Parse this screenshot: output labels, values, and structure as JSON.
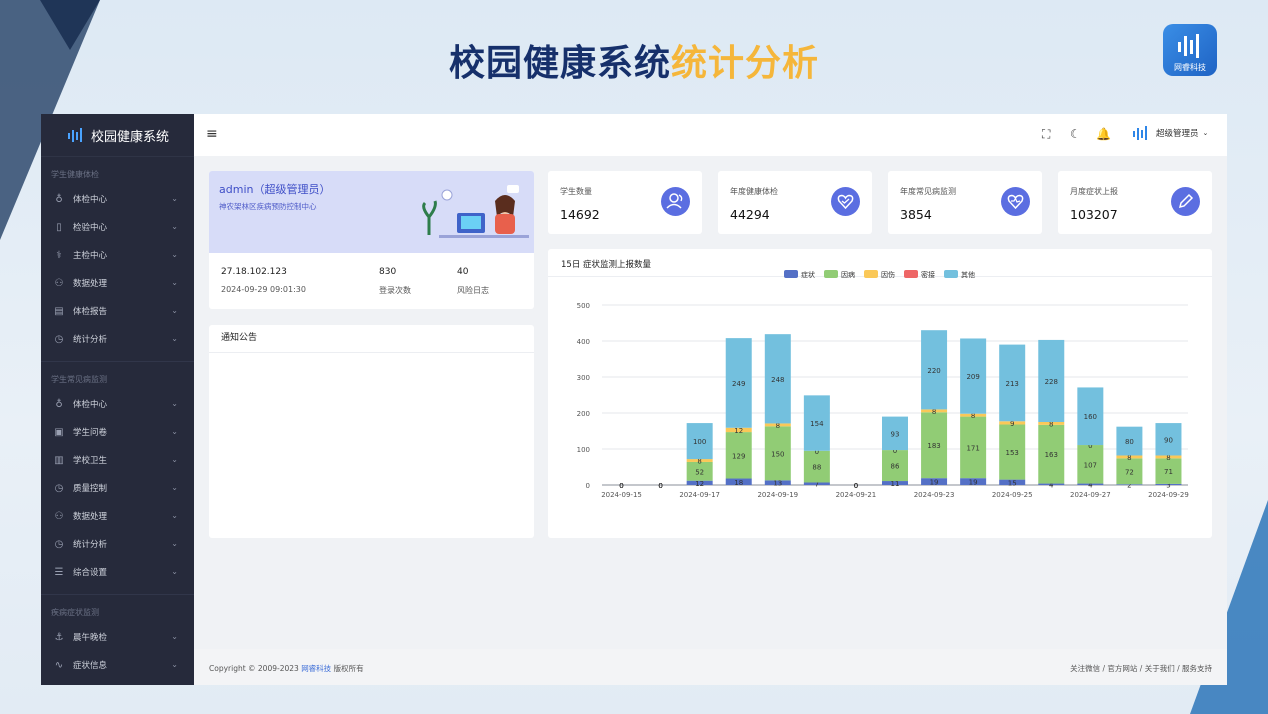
{
  "slide": {
    "title_main": "校园健康系统",
    "title_accent": "统计分析",
    "brand_name": "网睿科技"
  },
  "colors": {
    "accent": "#5b6ee1",
    "title": "#16306b",
    "title_accent": "#f5b63a",
    "sidebar": "#262a3b"
  },
  "sidebar": {
    "app_name": "校园健康系统",
    "sections": [
      {
        "title": "学生健康体检",
        "items": [
          {
            "label": "体检中心",
            "icon": "stethoscope-icon",
            "glyph": "♁"
          },
          {
            "label": "检验中心",
            "icon": "test-tube-icon",
            "glyph": "▯"
          },
          {
            "label": "主检中心",
            "icon": "doctor-icon",
            "glyph": "⚕"
          },
          {
            "label": "数据处理",
            "icon": "hierarchy-icon",
            "glyph": "⚇"
          },
          {
            "label": "体检报告",
            "icon": "report-icon",
            "glyph": "▤"
          },
          {
            "label": "统计分析",
            "icon": "clock-icon",
            "glyph": "◷"
          }
        ]
      },
      {
        "title": "学生常见病监测",
        "items": [
          {
            "label": "体检中心",
            "icon": "stethoscope-icon",
            "glyph": "♁"
          },
          {
            "label": "学生问卷",
            "icon": "document-icon",
            "glyph": "▣"
          },
          {
            "label": "学校卫生",
            "icon": "building-icon",
            "glyph": "▥"
          },
          {
            "label": "质量控制",
            "icon": "clock-icon",
            "glyph": "◷"
          },
          {
            "label": "数据处理",
            "icon": "hierarchy-icon",
            "glyph": "⚇"
          },
          {
            "label": "统计分析",
            "icon": "clock-icon",
            "glyph": "◷"
          },
          {
            "label": "综合设置",
            "icon": "settings-icon",
            "glyph": "☰"
          }
        ]
      },
      {
        "title": "疾病症状监测",
        "items": [
          {
            "label": "晨午晚检",
            "icon": "anchor-icon",
            "glyph": "⚓"
          },
          {
            "label": "症状信息",
            "icon": "pulse-icon",
            "glyph": "∿"
          }
        ]
      }
    ]
  },
  "header": {
    "menu_icon": "≡",
    "user": "超级管理员"
  },
  "welcome": {
    "name": "admin（超级管理员）",
    "org": "神农架林区疾病预防控制中心",
    "ip": "27.18.102.123",
    "login_time": "2024-09-29 09:01:30",
    "login_count": "830",
    "login_count_label": "登录次数",
    "risk_count": "40",
    "risk_label": "风险日志"
  },
  "notice": {
    "title": "通知公告"
  },
  "kpis": [
    {
      "label": "学生数量",
      "value": "14692",
      "icon": "users-icon",
      "glyph": "👥"
    },
    {
      "label": "年度健康体检",
      "value": "44294",
      "icon": "heart-check-icon",
      "glyph": "♥"
    },
    {
      "label": "年度常见病监测",
      "value": "3854",
      "icon": "heart-icon",
      "glyph": "♥"
    },
    {
      "label": "月度症状上报",
      "value": "103207",
      "icon": "pen-icon",
      "glyph": "✎"
    }
  ],
  "chart_title": "15日 症状监测上报数量",
  "chart_data": {
    "type": "bar",
    "stacked": true,
    "categories": [
      "2024-09-15",
      "2024-09-16",
      "2024-09-17",
      "2024-09-18",
      "2024-09-19",
      "2024-09-20",
      "2024-09-21",
      "2024-09-22",
      "2024-09-23",
      "2024-09-24",
      "2024-09-25",
      "2024-09-26",
      "2024-09-27",
      "2024-09-28",
      "2024-09-29"
    ],
    "x_tick_labels": [
      "2024-09-15",
      "2024-09-17",
      "2024-09-19",
      "2024-09-21",
      "2024-09-23",
      "2024-09-25",
      "2024-09-27",
      "2024-09-29"
    ],
    "ylim": [
      0,
      500
    ],
    "yticks": [
      0,
      100,
      200,
      300,
      400,
      500
    ],
    "legend_position": "top-center",
    "grid": true,
    "series": [
      {
        "name": "症状",
        "color": "#5470c6",
        "values": [
          0,
          0,
          12,
          18,
          13,
          7,
          0,
          11,
          19,
          19,
          15,
          4,
          4,
          2,
          3
        ]
      },
      {
        "name": "因病",
        "color": "#91cc75",
        "values": [
          0,
          0,
          52,
          129,
          150,
          88,
          0,
          86,
          183,
          171,
          153,
          163,
          107,
          72,
          71
        ]
      },
      {
        "name": "因伤",
        "color": "#fac858",
        "values": [
          0,
          0,
          8,
          12,
          8,
          0,
          0,
          0,
          8,
          8,
          9,
          8,
          0,
          8,
          8
        ]
      },
      {
        "name": "密接",
        "color": "#ee6666",
        "values": [
          0,
          0,
          0,
          0,
          0,
          0,
          0,
          0,
          0,
          0,
          0,
          0,
          0,
          0,
          0
        ]
      },
      {
        "name": "其他",
        "color": "#73c0de",
        "values": [
          0,
          0,
          100,
          249,
          248,
          154,
          0,
          93,
          220,
          209,
          213,
          228,
          160,
          80,
          90
        ]
      }
    ]
  },
  "footer": {
    "copy_prefix": "Copyright © 2009-2023 ",
    "copy_brand": "网睿科技",
    "copy_suffix": " 版权所有",
    "links": [
      "关注微信",
      "官方网站",
      "关于我们",
      "服务支持"
    ]
  }
}
